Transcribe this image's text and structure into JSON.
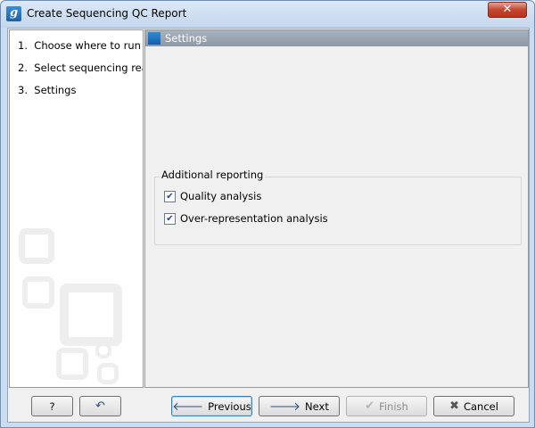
{
  "window": {
    "title": "Create Sequencing QC Report",
    "app_icon_glyph": "g",
    "close_glyph": "✕"
  },
  "steps": [
    {
      "number": "1.",
      "label": "Choose where to run"
    },
    {
      "number": "2.",
      "label": "Select sequencing reads"
    },
    {
      "number": "3.",
      "label": "Settings"
    }
  ],
  "settings": {
    "header": "Settings",
    "group": {
      "label": "Additional reporting",
      "options": [
        {
          "label": "Quality analysis",
          "checked": true
        },
        {
          "label": "Over-representation analysis",
          "checked": true
        }
      ]
    }
  },
  "buttons": {
    "help": "?",
    "reset_icon": "↶",
    "previous": "Previous",
    "next": "Next",
    "finish": "Finish",
    "cancel": "Cancel"
  },
  "colors": {
    "title_bar": "#c4d7ee",
    "close_button": "#c4452f",
    "settings_header": "#8d98a6",
    "accent_icon": "#1d5fa6"
  }
}
